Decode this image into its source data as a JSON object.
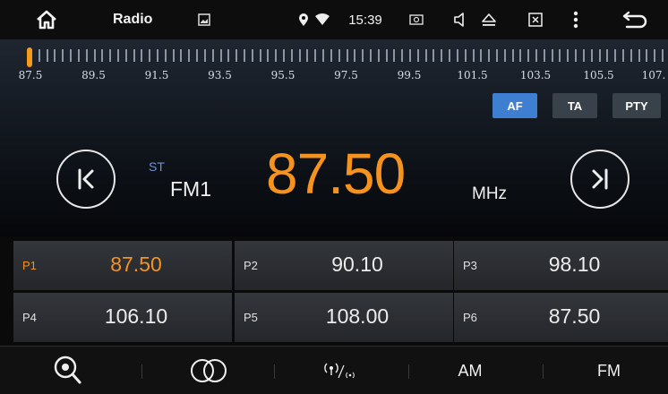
{
  "status_bar": {
    "title": "Radio",
    "time": "15:39",
    "icons": [
      "home-icon",
      "image-icon",
      "location-icon",
      "wifi-icon",
      "screenshot-icon",
      "volume-icon",
      "eject-icon",
      "close-window-icon",
      "more-icon",
      "back-icon"
    ]
  },
  "dial": {
    "labels": [
      "87.5",
      "89.5",
      "91.5",
      "93.5",
      "95.5",
      "97.5",
      "99.5",
      "101.5",
      "103.5",
      "105.5",
      "107."
    ],
    "needle_frequency": 87.5
  },
  "modes": {
    "af": "AF",
    "ta": "TA",
    "pty": "PTY",
    "active": "AF"
  },
  "tuner": {
    "stereo": "ST",
    "band": "FM1",
    "frequency": "87.50",
    "unit": "MHz"
  },
  "presets": [
    {
      "label": "P1",
      "value": "87.50",
      "active": true
    },
    {
      "label": "P2",
      "value": "90.10",
      "active": false
    },
    {
      "label": "P3",
      "value": "98.10",
      "active": false
    },
    {
      "label": "P4",
      "value": "106.10",
      "active": false
    },
    {
      "label": "P5",
      "value": "108.00",
      "active": false
    },
    {
      "label": "P6",
      "value": "87.50",
      "active": false
    }
  ],
  "bottom_bar": {
    "am": "AM",
    "fm": "FM",
    "icons": [
      "search-icon",
      "loop-icon",
      "scan-icon"
    ]
  },
  "colors": {
    "accent": "#f5931e",
    "af_active": "#3f7fd1",
    "stereo": "#6e8fd6"
  }
}
